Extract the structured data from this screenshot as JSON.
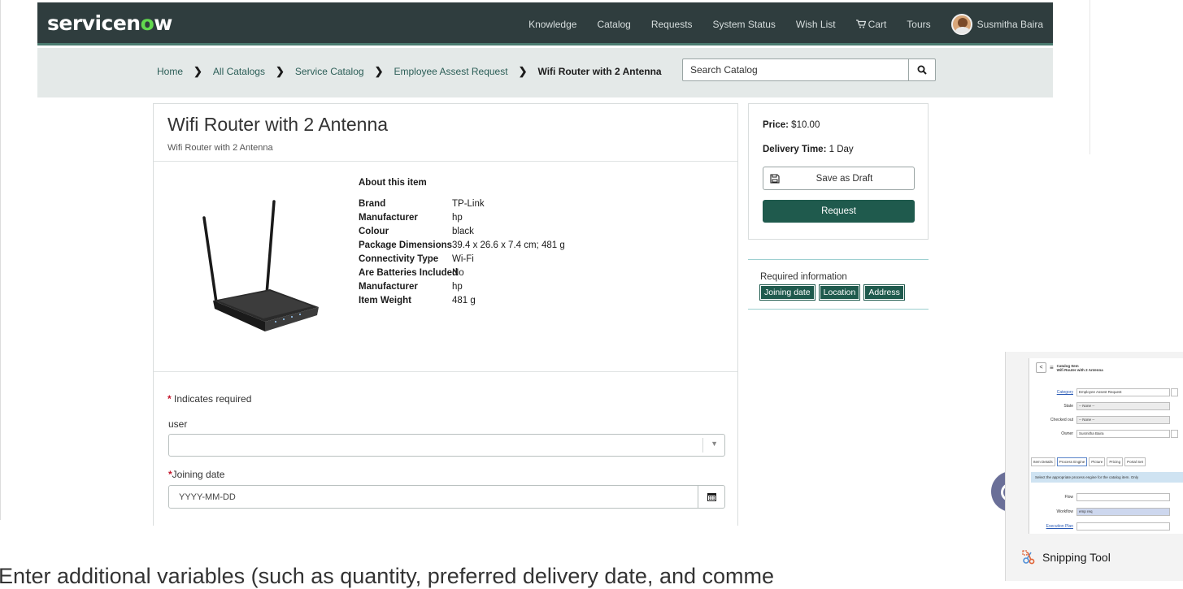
{
  "navbar": {
    "logo": "servicenow",
    "logo_prefix": "servicen",
    "logo_o": "o",
    "logo_suffix": "w",
    "links": [
      "Knowledge",
      "Catalog",
      "Requests",
      "System Status",
      "Wish List"
    ],
    "cart_label": "Cart",
    "tours_label": "Tours",
    "user_name": "Susmitha Baira"
  },
  "breadcrumb": {
    "items": [
      "Home",
      "All Catalogs",
      "Service Catalog",
      "Employee Assest Request"
    ],
    "current": "Wifi Router with 2 Antenna"
  },
  "search": {
    "placeholder": "Search Catalog"
  },
  "item": {
    "title": "Wifi Router with 2 Antenna",
    "subtitle": "Wifi Router with 2 Antenna",
    "about_heading": "About this item",
    "specs": [
      {
        "key": "Brand",
        "value": "TP-Link"
      },
      {
        "key": "Manufacturer",
        "value": "hp"
      },
      {
        "key": "Colour",
        "value": "black"
      },
      {
        "key": "Package Dimensions",
        "value": "39.4 x 26.6 x 7.4 cm; 481 g"
      },
      {
        "key": "Connectivity Type",
        "value": "Wi-Fi"
      },
      {
        "key": "Are Batteries Included",
        "value": "No"
      },
      {
        "key": "Manufacturer",
        "value": "hp"
      },
      {
        "key": "Item Weight",
        "value": "481 g"
      }
    ]
  },
  "form": {
    "required_note": "Indicates required",
    "required_star": "*",
    "user_label": "user",
    "user_value": "",
    "joining_label": "Joining date",
    "joining_placeholder": "YYYY-MM-DD"
  },
  "order": {
    "price_label": "Price:",
    "price_value": "$10.00",
    "delivery_label": "Delivery Time:",
    "delivery_value": "1 Day",
    "save_draft": "Save as Draft",
    "request": "Request"
  },
  "required_info": {
    "title": "Required information",
    "tags": [
      "Joining date",
      "Location",
      "Address"
    ]
  },
  "snipping_tool": {
    "label": "Snipping Tool",
    "thumb_title_1": "Catalog Item",
    "thumb_title_2": "Wifi Router with 2 Antenna",
    "fields": [
      {
        "label": "Category",
        "value": "Employee Assest Request"
      },
      {
        "label": "State",
        "value": "-- None --"
      },
      {
        "label": "Checked out",
        "value": "-- None --"
      },
      {
        "label": "Owner",
        "value": "Susmitha Baira"
      }
    ],
    "tabs": [
      "Item Details",
      "Process Engine",
      "Picture",
      "Pricing",
      "Portal Set"
    ],
    "info": "Select the appropriate process engine for the catalog item. Only",
    "flow_label": "Flow",
    "flow_value": "",
    "workflow_label": "Workflow",
    "workflow_value": "emp req",
    "execution_plan": "Execution Plan"
  },
  "bottom_text": "Enter additional variables (such as quantity, preferred delivery date, and comme",
  "colors": {
    "navbar_bg": "#2f3d3e",
    "accent_green": "#1f5a4d",
    "logo_o_green": "#62d84e",
    "breadcrumb_bg": "#e4e9e8",
    "required_red": "#c4152b"
  }
}
